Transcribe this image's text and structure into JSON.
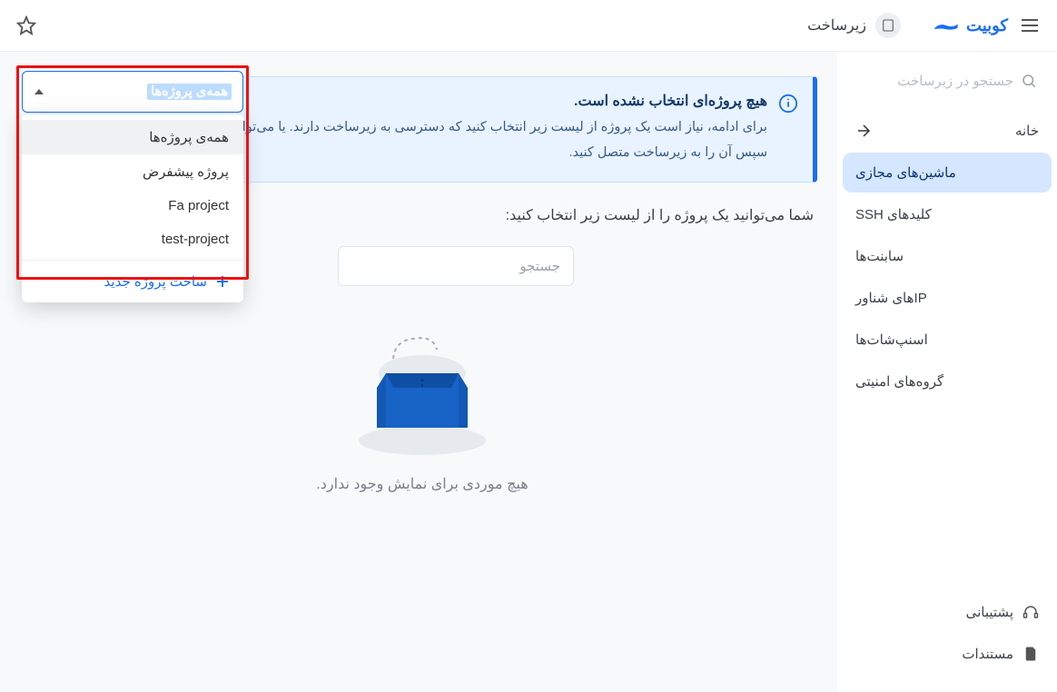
{
  "header": {
    "brand": "کوبیت",
    "breadcrumb": "زیرساخت"
  },
  "sidebar": {
    "search_placeholder": "جستجو در زیرساخت",
    "home_label": "خانه",
    "items": [
      {
        "label": "ماشین‌های مجازی"
      },
      {
        "label": "کلیدهای SSH"
      },
      {
        "label": "سابنت‌ها"
      },
      {
        "label": "IPهای شناور"
      },
      {
        "label": "اسنپ‌شات‌ها"
      },
      {
        "label": "گروه‌های امنیتی"
      }
    ],
    "bottom": {
      "support": "پشتیبانی",
      "docs": "مستندات"
    }
  },
  "alert": {
    "title": "هیچ پروژه‌ای انتخاب نشده است.",
    "body": "برای ادامه، نیاز است یک پروژه از لیست زیر انتخاب کنید که دسترسی به زیرساخت دارند. یا می‌توانید یکی را انتخاب و سپس آن را به زیرساخت متصل کنید."
  },
  "main": {
    "subtitle": "شما می‌توانید یک پروژه را از لیست زیر انتخاب کنید:",
    "search_placeholder": "جستجو",
    "empty_text": "هیچ موردی برای نمایش وجود ندارد."
  },
  "project_selector": {
    "selected": "همه‌ی پروژه‌ها",
    "options": [
      "همه‌ی پروژه‌ها",
      "پروژه پیشفرض",
      "Fa project",
      "test-project"
    ],
    "new_project": "ساخت پروژه جدید"
  }
}
